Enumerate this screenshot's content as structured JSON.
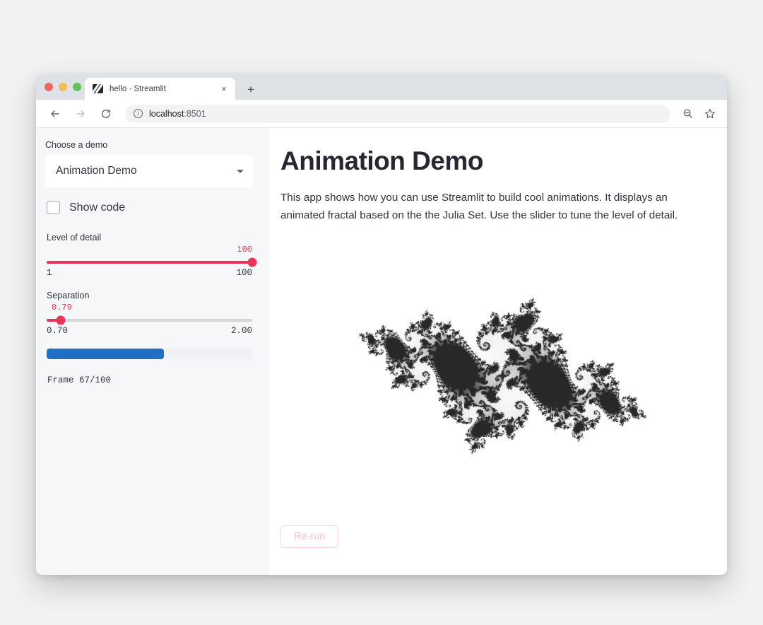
{
  "browser": {
    "tab": {
      "title": "hello · Streamlit",
      "favicon_name": "streamlit-logo-icon",
      "close_label": "×"
    },
    "new_tab_label": "+",
    "nav": {
      "back_label": "←",
      "forward_label": "→",
      "reload_label": "⟳"
    },
    "url": {
      "host": "localhost",
      "port": ":8501",
      "info_label": "i"
    },
    "right_icons": [
      "zoom-icon",
      "bookmark-star-icon"
    ]
  },
  "sidebar": {
    "select_label": "Choose a demo",
    "select_value": "Animation Demo",
    "select_options": [
      "Animation Demo"
    ],
    "checkbox": {
      "label": "Show code",
      "checked": false
    },
    "sliders": [
      {
        "title": "Level of detail",
        "value": "100",
        "value_number": 100,
        "min_label": "1",
        "max_label": "100",
        "min": 1,
        "max": 100,
        "percent": 100
      },
      {
        "title": "Separation",
        "value": "0.79",
        "value_number": 0.79,
        "min_label": "0.70",
        "max_label": "2.00",
        "min": 0.7,
        "max": 2.0,
        "percent": 6.9
      }
    ],
    "progress": {
      "percent": 57,
      "status": "Frame 67/100"
    }
  },
  "main": {
    "title": "Animation Demo",
    "description": "This app shows how you can use Streamlit to build cool animations. It displays an animated fractal based on the the Julia Set. Use the slider to tune the level of detail.",
    "image_name": "julia-set-fractal",
    "rerun_label": "Re-run"
  },
  "colors": {
    "accent": "#e8365b",
    "progress": "#1f6fc4",
    "text": "#31333f",
    "heading": "#262730",
    "sidebar_bg": "#f6f7f9",
    "rerun_border": "#fbd5dd",
    "rerun_text": "#f6c0ca"
  }
}
